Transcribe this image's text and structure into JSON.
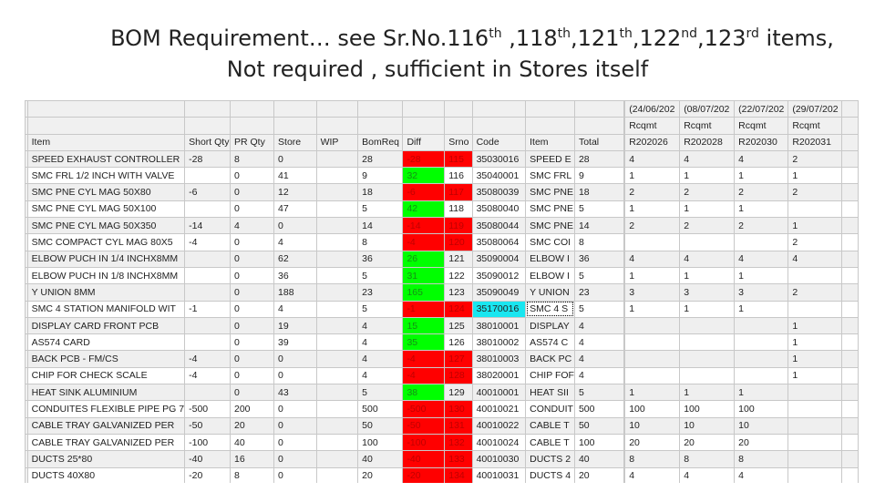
{
  "title": {
    "line1": {
      "prefix": "BOM Requirement… see Sr.No.",
      "n1": "116",
      "s1": "th",
      "n2": " ,118",
      "s2": "th",
      "n3": ",121",
      "s3": "th",
      "n4": ",122",
      "s4": "nd",
      "n5": ",123",
      "s5": "rd",
      "suffix": " items,"
    },
    "line2": "Not required , sufficient in Stores itself"
  },
  "colors": {
    "shortage": "#ff0000",
    "surplus": "#00ff00",
    "selected_code": "#19e6f0"
  },
  "header_rows": [
    [
      "",
      "",
      "",
      "",
      "",
      "",
      "",
      "",
      "",
      "",
      "",
      "",
      "(24/06/202",
      "(08/07/202",
      "(22/07/202",
      "(29/07/202",
      ""
    ],
    [
      "",
      "",
      "",
      "",
      "",
      "",
      "",
      "",
      "",
      "",
      "",
      "",
      "Rcqmt",
      "Rcqmt",
      "Rcqmt",
      "Rcqmt",
      ""
    ],
    [
      "Item",
      "Short Qty",
      "PR Qty",
      "Store",
      "WIP",
      "BomReq",
      "Diff",
      "Srno",
      "Code",
      "Item",
      "Total",
      "",
      "R202026",
      "R202028",
      "R202030",
      "R202031",
      ""
    ]
  ],
  "rows": [
    {
      "item": "SPEED EXHAUST CONTROLLER",
      "short": "-28",
      "pr": "8",
      "store": "0",
      "wip": "",
      "bom": "28",
      "diff": "-28",
      "srno": "115",
      "code": "35030016",
      "item2": "SPEED E",
      "total": "28",
      "r": [
        "4",
        "4",
        "4",
        "2"
      ],
      "status": "short"
    },
    {
      "item": "SMC FRL 1/2 INCH WITH  VALVE",
      "short": "",
      "pr": "0",
      "store": "41",
      "wip": "",
      "bom": "9",
      "diff": "32",
      "srno": "116",
      "code": "35040001",
      "item2": "SMC FRL",
      "total": "9",
      "r": [
        "1",
        "1",
        "1",
        "1"
      ],
      "status": "ok"
    },
    {
      "item": "SMC PNE CYL MAG 50X80",
      "short": "-6",
      "pr": "0",
      "store": "12",
      "wip": "",
      "bom": "18",
      "diff": "-6",
      "srno": "117",
      "code": "35080039",
      "item2": "SMC PNE",
      "total": "18",
      "r": [
        "2",
        "2",
        "2",
        "2"
      ],
      "status": "short"
    },
    {
      "item": "SMC PNE CYL MAG 50X100",
      "short": "",
      "pr": "0",
      "store": "47",
      "wip": "",
      "bom": "5",
      "diff": "42",
      "srno": "118",
      "code": "35080040",
      "item2": "SMC PNE",
      "total": "5",
      "r": [
        "1",
        "1",
        "1",
        ""
      ],
      "status": "ok"
    },
    {
      "item": "SMC PNE CYL MAG 50X350",
      "short": "-14",
      "pr": "4",
      "store": "0",
      "wip": "",
      "bom": "14",
      "diff": "-14",
      "srno": "119",
      "code": "35080044",
      "item2": "SMC PNE",
      "total": "14",
      "r": [
        "2",
        "2",
        "2",
        "1"
      ],
      "status": "short"
    },
    {
      "item": "SMC COMPACT CYL MAG 80X5",
      "short": "-4",
      "pr": "0",
      "store": "4",
      "wip": "",
      "bom": "8",
      "diff": "-4",
      "srno": "120",
      "code": "35080064",
      "item2": "SMC COI",
      "total": "8",
      "r": [
        "",
        "",
        "",
        "2"
      ],
      "status": "short"
    },
    {
      "item": "ELBOW PUCH IN 1/4 INCHX8MM",
      "short": "",
      "pr": "0",
      "store": "62",
      "wip": "",
      "bom": "36",
      "diff": "26",
      "srno": "121",
      "code": "35090004",
      "item2": "ELBOW I",
      "total": "36",
      "r": [
        "4",
        "4",
        "4",
        "4"
      ],
      "status": "ok"
    },
    {
      "item": "ELBOW PUCH IN 1/8 INCHX8MM",
      "short": "",
      "pr": "0",
      "store": "36",
      "wip": "",
      "bom": "5",
      "diff": "31",
      "srno": "122",
      "code": "35090012",
      "item2": "ELBOW I",
      "total": "5",
      "r": [
        "1",
        "1",
        "1",
        ""
      ],
      "status": "ok"
    },
    {
      "item": "Y UNION 8MM",
      "short": "",
      "pr": "0",
      "store": "188",
      "wip": "",
      "bom": "23",
      "diff": "165",
      "srno": "123",
      "code": "35090049",
      "item2": "Y UNION",
      "total": "23",
      "r": [
        "3",
        "3",
        "3",
        "2"
      ],
      "status": "ok"
    },
    {
      "item": "SMC 4 STATION  MANIFOLD WIT",
      "short": "-1",
      "pr": "0",
      "store": "4",
      "wip": "",
      "bom": "5",
      "diff": "-1",
      "srno": "124",
      "code": "35170016",
      "item2": "SMC 4 S",
      "total": "5",
      "r": [
        "1",
        "1",
        "1",
        ""
      ],
      "status": "short",
      "selected": true
    },
    {
      "item": "DISPLAY CARD FRONT PCB",
      "short": "",
      "pr": "0",
      "store": "19",
      "wip": "",
      "bom": "4",
      "diff": "15",
      "srno": "125",
      "code": "38010001",
      "item2": "DISPLAY",
      "total": "4",
      "r": [
        "",
        "",
        "",
        "1"
      ],
      "status": "ok"
    },
    {
      "item": "AS574 CARD",
      "short": "",
      "pr": "0",
      "store": "39",
      "wip": "",
      "bom": "4",
      "diff": "35",
      "srno": "126",
      "code": "38010002",
      "item2": "AS574 C",
      "total": "4",
      "r": [
        "",
        "",
        "",
        "1"
      ],
      "status": "ok"
    },
    {
      "item": "BACK PCB - FM/CS",
      "short": "-4",
      "pr": "0",
      "store": "0",
      "wip": "",
      "bom": "4",
      "diff": "-4",
      "srno": "127",
      "code": "38010003",
      "item2": "BACK PC",
      "total": "4",
      "r": [
        "",
        "",
        "",
        "1"
      ],
      "status": "short"
    },
    {
      "item": "CHIP FOR CHECK SCALE",
      "short": "-4",
      "pr": "0",
      "store": "0",
      "wip": "",
      "bom": "4",
      "diff": "-4",
      "srno": "128",
      "code": "38020001",
      "item2": "CHIP FOF",
      "total": "4",
      "r": [
        "",
        "",
        "",
        "1"
      ],
      "status": "short"
    },
    {
      "item": "HEAT SINK ALUMINIUM",
      "short": "",
      "pr": "0",
      "store": "43",
      "wip": "",
      "bom": "5",
      "diff": "38",
      "srno": "129",
      "code": "40010001",
      "item2": "HEAT SII",
      "total": "5",
      "r": [
        "1",
        "1",
        "1",
        ""
      ],
      "status": "ok"
    },
    {
      "item": "CONDUITES FLEXIBLE PIPE PG 7",
      "short": "-500",
      "pr": "200",
      "store": "0",
      "wip": "",
      "bom": "500",
      "diff": "-500",
      "srno": "130",
      "code": "40010021",
      "item2": "CONDUIT",
      "total": "500",
      "r": [
        "100",
        "100",
        "100",
        ""
      ],
      "status": "short"
    },
    {
      "item": "CABLE TRAY GALVANIZED PER",
      "short": "-50",
      "pr": "20",
      "store": "0",
      "wip": "",
      "bom": "50",
      "diff": "-50",
      "srno": "131",
      "code": "40010022",
      "item2": "CABLE T",
      "total": "50",
      "r": [
        "10",
        "10",
        "10",
        ""
      ],
      "status": "short"
    },
    {
      "item": "CABLE TRAY GALVANIZED PER",
      "short": "-100",
      "pr": "40",
      "store": "0",
      "wip": "",
      "bom": "100",
      "diff": "-100",
      "srno": "132",
      "code": "40010024",
      "item2": "CABLE T",
      "total": "100",
      "r": [
        "20",
        "20",
        "20",
        ""
      ],
      "status": "short"
    },
    {
      "item": "DUCTS 25*80",
      "short": "-40",
      "pr": "16",
      "store": "0",
      "wip": "",
      "bom": "40",
      "diff": "-40",
      "srno": "133",
      "code": "40010030",
      "item2": "DUCTS 2",
      "total": "40",
      "r": [
        "8",
        "8",
        "8",
        ""
      ],
      "status": "short"
    },
    {
      "item": "DUCTS 40X80",
      "short": "-20",
      "pr": "8",
      "store": "0",
      "wip": "",
      "bom": "20",
      "diff": "-20",
      "srno": "134",
      "code": "40010031",
      "item2": "DUCTS 4",
      "total": "20",
      "r": [
        "4",
        "4",
        "4",
        ""
      ],
      "status": "short"
    }
  ]
}
